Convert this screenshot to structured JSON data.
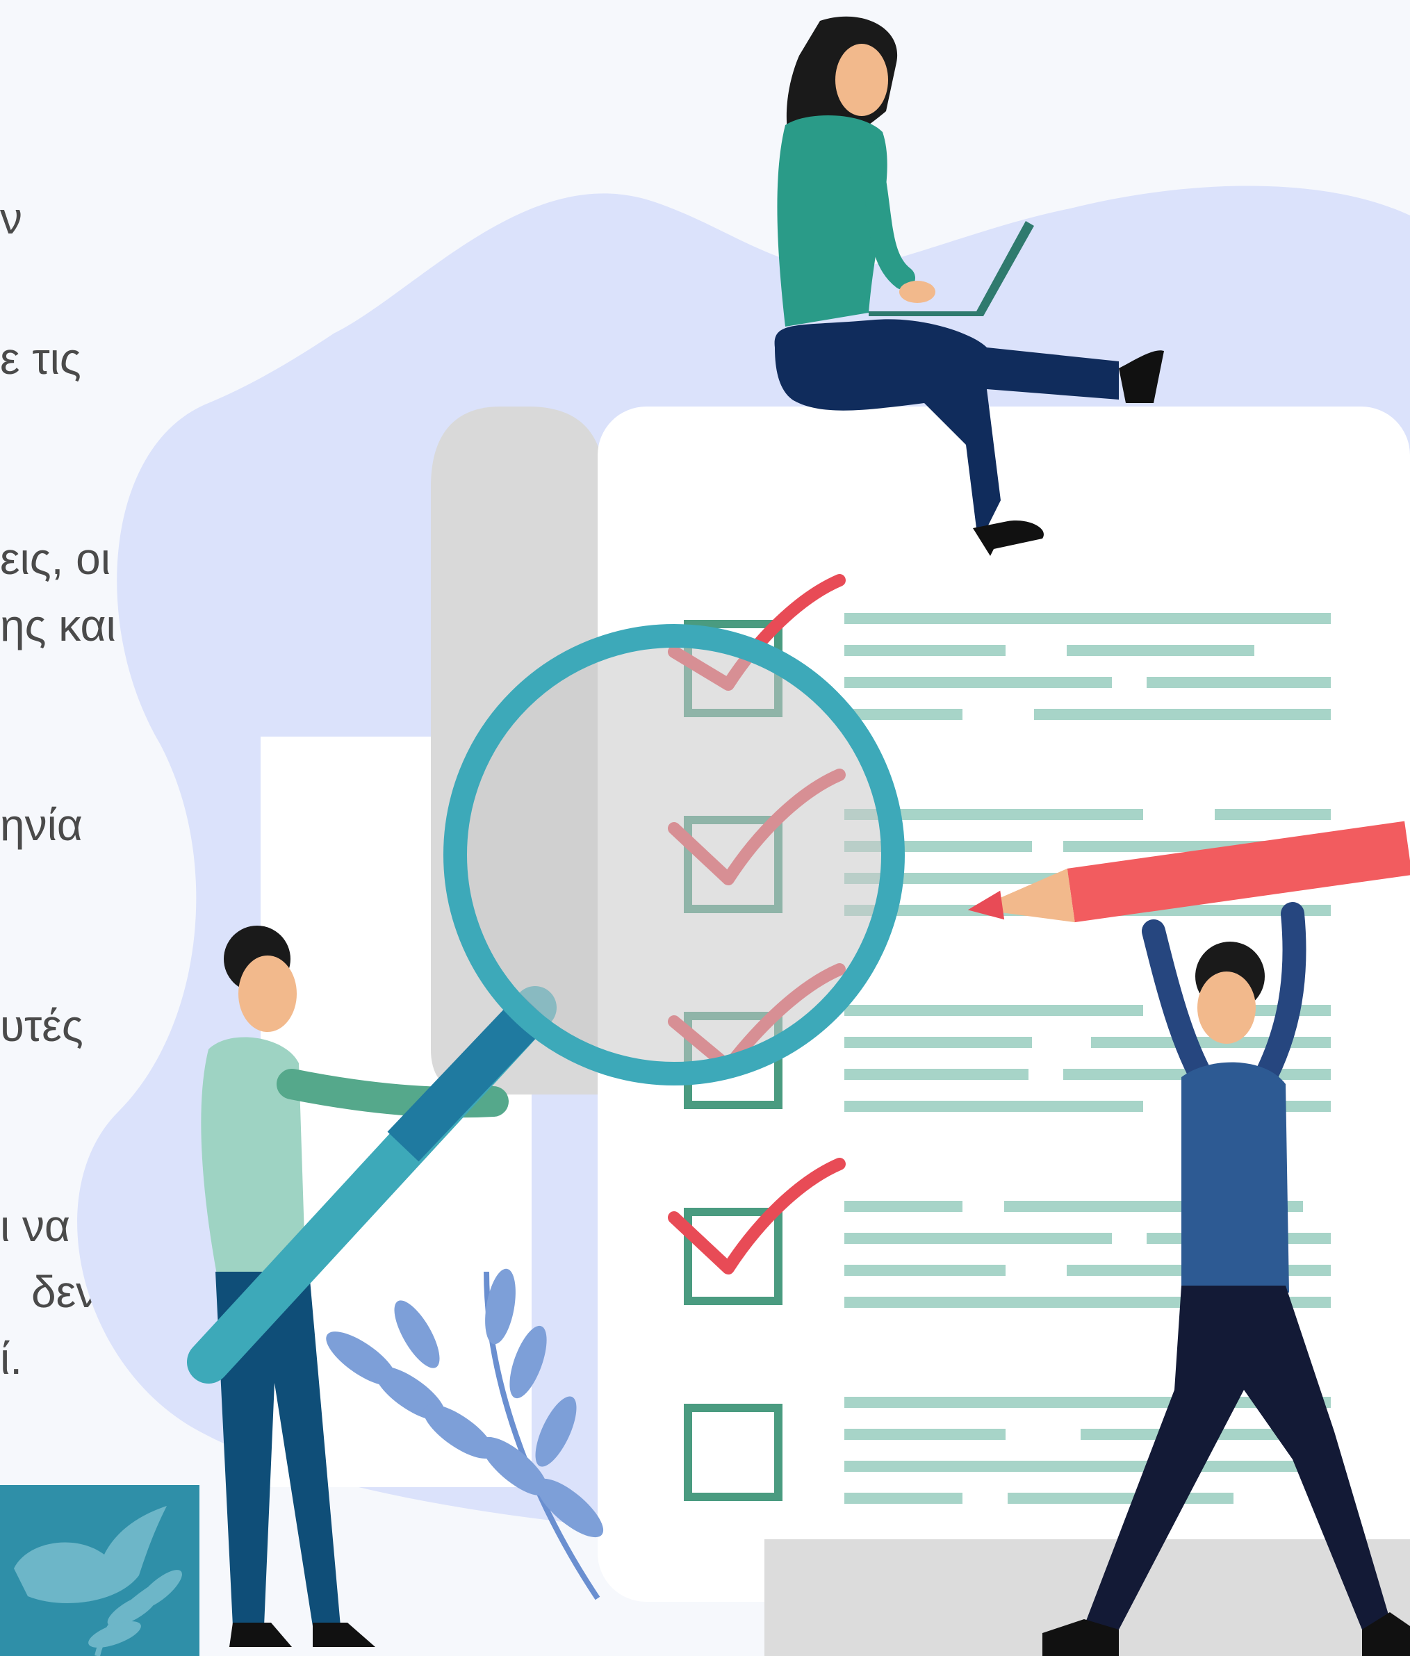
{
  "text_fragments": [
    "ν",
    "ε τις",
    "εις, οι",
    "ης και",
    "ηνία",
    "υτές",
    "ι να",
    "δεν",
    "ί."
  ],
  "colors": {
    "background": "#f6f8fc",
    "blob": "#dbe2fb",
    "teal": "#3da9b9",
    "check_red": "#e84b56",
    "checkbox_green": "#4a9b80",
    "text_line": "#a7d4c8",
    "pencil": "#f25c5f",
    "logo_tile": "#2f8fa8"
  },
  "illustration": {
    "checklist_items": [
      {
        "checked": true
      },
      {
        "checked": true
      },
      {
        "checked": true
      },
      {
        "checked": true
      },
      {
        "checked": false
      }
    ]
  }
}
